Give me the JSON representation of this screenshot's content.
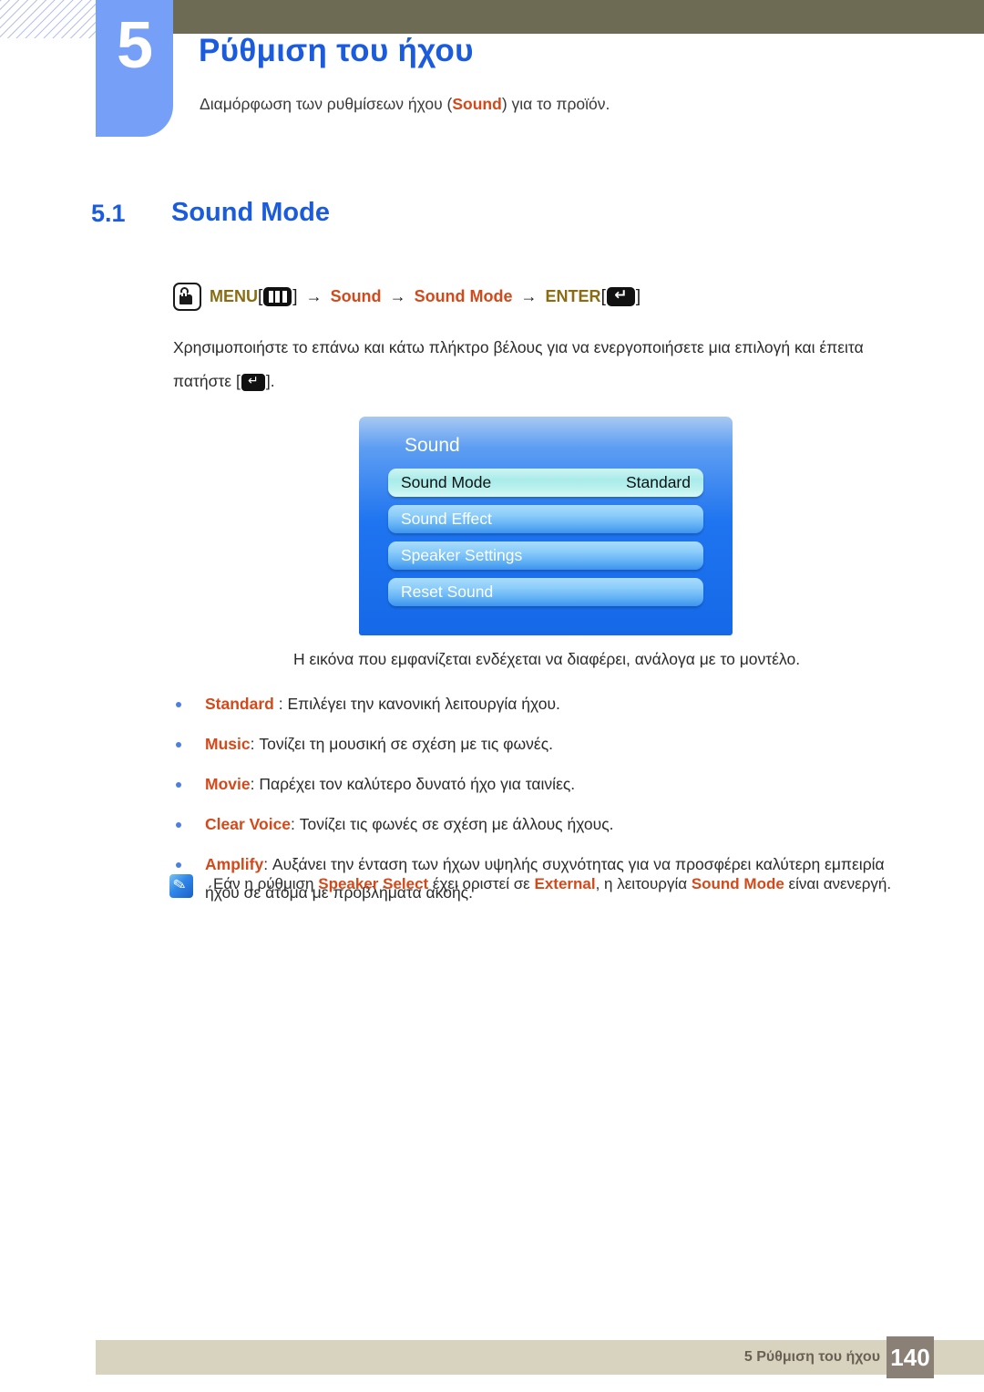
{
  "header": {
    "chapter_number": "5",
    "chapter_title": "Ρύθμιση του ήχου",
    "subtitle_before": "Διαμόρφωση των ρυθμίσεων ήχου (",
    "subtitle_keyword": "Sound",
    "subtitle_after": ") για το προϊόν."
  },
  "section": {
    "number": "5.1",
    "title": "Sound Mode"
  },
  "menu_path": {
    "menu_label": "MENU",
    "menu_icon": "menu-bars-icon",
    "arrow": "→",
    "step_sound": "Sound",
    "step_sound_mode": "Sound Mode",
    "enter_label": "ENTER",
    "enter_icon": "enter-key-icon",
    "touch_icon": "touch-hand-icon",
    "bracket_open": "[",
    "bracket_close": "]"
  },
  "body": {
    "paragraph_part1": "Χρησιμοποιήστε το επάνω και κάτω πλήκτρο βέλους για να ενεργοποιήσετε μια επιλογή και έπειτα πατήστε [",
    "paragraph_part2": "]."
  },
  "osd": {
    "title": "Sound",
    "rows": [
      {
        "label": "Sound Mode",
        "value": "Standard",
        "selected": true
      },
      {
        "label": "Sound Effect",
        "value": "",
        "selected": false
      },
      {
        "label": "Speaker Settings",
        "value": "",
        "selected": false
      },
      {
        "label": "Reset Sound",
        "value": "",
        "selected": false
      }
    ],
    "caption": "Η εικόνα που εμφανίζεται ενδέχεται να διαφέρει, ανάλογα με το μοντέλο."
  },
  "bullets": [
    {
      "keyword": "Standard",
      "text": " : Επιλέγει την κανονική λειτουργία ήχου."
    },
    {
      "keyword": "Music",
      "text": ": Τονίζει τη μουσική σε σχέση με τις φωνές."
    },
    {
      "keyword": "Movie",
      "text": ": Παρέχει τον καλύτερο δυνατό ήχο για ταινίες."
    },
    {
      "keyword": "Clear Voice",
      "text": ": Τονίζει τις φωνές σε σχέση με άλλους ήχους."
    },
    {
      "keyword": "Amplify",
      "text": ": Αυξάνει την ένταση των ήχων υψηλής συχνότητας για να προσφέρει καλύτερη εμπειρία ήχου σε άτομα με προβλήματα ακοής."
    }
  ],
  "note": {
    "icon": "note-pencil-icon",
    "part1": "Εάν η ρύθμιση ",
    "kw1": "Speaker Select",
    "part2": " έχει οριστεί σε ",
    "kw2": "External",
    "part3": ", η λειτουργία ",
    "kw3": "Sound Mode",
    "part4": " είναι ανενεργή."
  },
  "footer": {
    "label": "5 Ρύθμιση του ήχου",
    "page": "140"
  },
  "colors": {
    "accent_blue": "#1b5bdd",
    "tab_blue": "#76a0f7",
    "olive": "#6e6b55",
    "orange": "#d4491a",
    "olive_text": "#8a6d12",
    "footer_bar": "#d8d3bf",
    "footer_page_box": "#8b8076"
  }
}
